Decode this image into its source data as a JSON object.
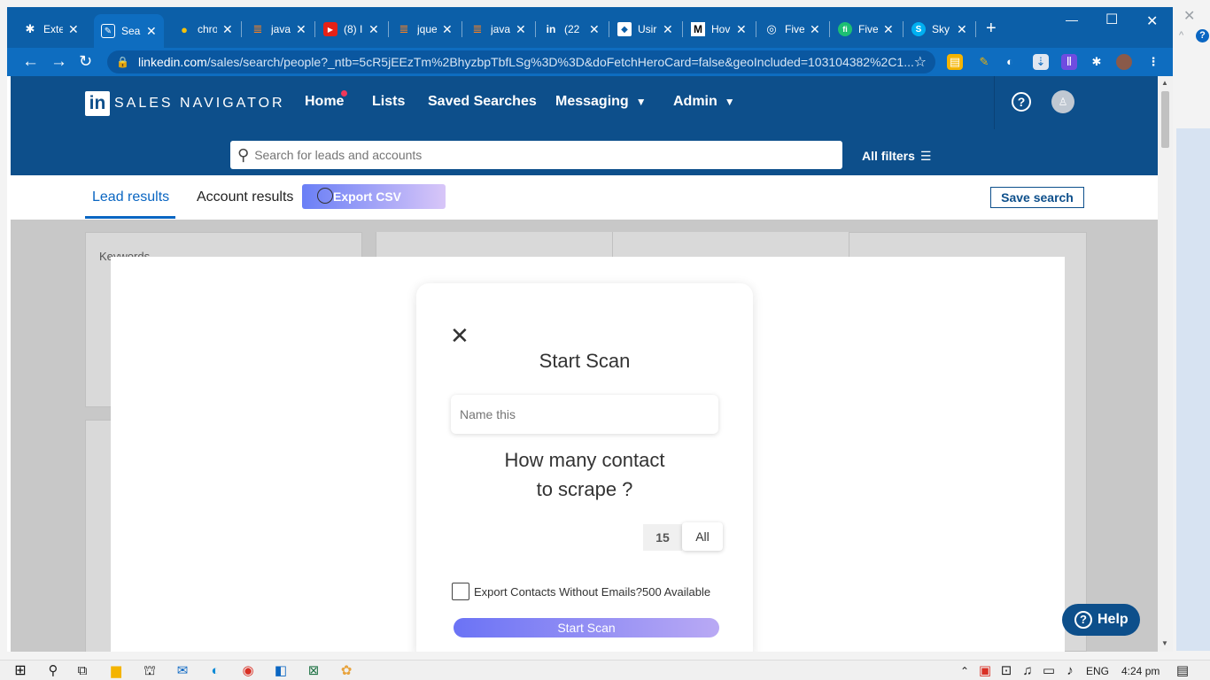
{
  "browser": {
    "tabs": [
      {
        "label": "Exte",
        "icon": "puzzle-icon",
        "glyph": "✱"
      },
      {
        "label": "Sea",
        "icon": "linkedin-edit-icon",
        "glyph": "✎",
        "active": true
      },
      {
        "label": "chro",
        "icon": "chrome-icon",
        "glyph": "●"
      },
      {
        "label": "java",
        "icon": "stackoverflow-icon",
        "glyph": "≣"
      },
      {
        "label": "(8) I",
        "icon": "youtube-icon",
        "glyph": "▶"
      },
      {
        "label": "jque",
        "icon": "stackoverflow-icon",
        "glyph": "≣"
      },
      {
        "label": "java",
        "icon": "stackoverflow-icon",
        "glyph": "≣"
      },
      {
        "label": "(22",
        "icon": "linkedin-icon",
        "glyph": "in"
      },
      {
        "label": "Usir",
        "icon": "bookmark-icon",
        "glyph": "◆"
      },
      {
        "label": "Hov",
        "icon": "medium-icon",
        "glyph": "M"
      },
      {
        "label": "Five",
        "icon": "globe-icon",
        "glyph": "◎"
      },
      {
        "label": "Five",
        "icon": "fiverr-icon",
        "glyph": "fi"
      },
      {
        "label": "Sky",
        "icon": "skype-icon",
        "glyph": "S"
      }
    ],
    "new_tab": "+",
    "url_host": "linkedin.com",
    "url_path": "/sales/search/people?_ntb=5cR5jEEzTm%2BhyzbpTbfLSg%3D%3D&doFetchHeroCard=false&geoIncluded=103104382%2C1..."
  },
  "nav": {
    "logo_in": "in",
    "brand": "SALES NAVIGATOR",
    "home": "Home",
    "lists": "Lists",
    "saved_searches": "Saved Searches",
    "messaging": "Messaging",
    "admin": "Admin"
  },
  "search": {
    "placeholder": "Search for leads and accounts",
    "all_filters": "All filters"
  },
  "tabs": {
    "lead_results": "Lead results",
    "account_results": "Account results",
    "export_csv": "Export CSV",
    "save_search": "Save search"
  },
  "background": {
    "keywords": "Keywords"
  },
  "modal": {
    "title": "Start Scan",
    "name_placeholder": "Name this",
    "question_line1": "How many contact",
    "question_line2": "to scrape ?",
    "count": "15",
    "all_label": "All",
    "checkbox_label": "Export Contacts Without Emails?500 Available",
    "start_button": "Start Scan"
  },
  "help": "Help",
  "taskbar": {
    "lang": "ENG",
    "time": "4:24 pm"
  },
  "colors": {
    "chrome_blue": "#0c5fa8",
    "linkedin_navy": "#0d4f8b",
    "accent_blue": "#0a66c2",
    "gradient_start": "#6a7ff6",
    "gradient_end": "#d8c6f8"
  }
}
